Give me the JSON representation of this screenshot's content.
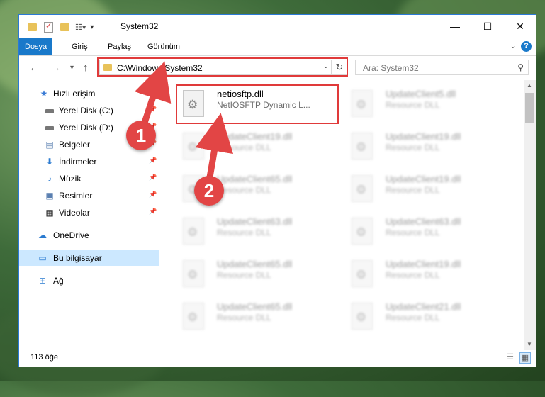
{
  "window": {
    "title": "System32",
    "controls": {
      "minimize": "—",
      "maximize": "☐",
      "close": "✕"
    }
  },
  "ribbon": {
    "tabs": [
      "Dosya",
      "Giriş",
      "Paylaş",
      "Görünüm"
    ],
    "help": "?"
  },
  "address": {
    "path": "C:\\Windows\\System32",
    "search_placeholder": "Ara: System32"
  },
  "navpane": {
    "items": [
      {
        "label": "Hızlı erişim",
        "icon": "star-icon",
        "pinned": false
      },
      {
        "label": "Yerel Disk (C:)",
        "icon": "drive-icon",
        "pinned": true
      },
      {
        "label": "Yerel Disk (D:)",
        "icon": "drive-icon",
        "pinned": true
      },
      {
        "label": "Belgeler",
        "icon": "document-icon",
        "pinned": true
      },
      {
        "label": "İndirmeler",
        "icon": "download-icon",
        "pinned": true
      },
      {
        "label": "Müzik",
        "icon": "music-icon",
        "pinned": true
      },
      {
        "label": "Resimler",
        "icon": "picture-icon",
        "pinned": true
      },
      {
        "label": "Videolar",
        "icon": "video-icon",
        "pinned": true
      },
      {
        "label": "OneDrive",
        "icon": "cloud-icon",
        "pinned": false
      },
      {
        "label": "Bu bilgisayar",
        "icon": "computer-icon",
        "pinned": false,
        "selected": true
      },
      {
        "label": "Ağ",
        "icon": "network-icon",
        "pinned": false
      }
    ]
  },
  "files": [
    {
      "name": "netiosftp.dll",
      "desc": "NetIOSFTP Dynamic L...",
      "highlighted": true
    },
    {
      "name": "UpdateClient5.dll",
      "desc": "Resource DLL"
    },
    {
      "name": "UpdateClient19.dll",
      "desc": "Resource DLL"
    },
    {
      "name": "UpdateClient19.dll",
      "desc": "Resource DLL"
    },
    {
      "name": "UpdateClient65.dll",
      "desc": "Resource DLL"
    },
    {
      "name": "UpdateClient19.dll",
      "desc": "Resource DLL"
    },
    {
      "name": "UpdateClient63.dll",
      "desc": "Resource DLL"
    },
    {
      "name": "UpdateClient63.dll",
      "desc": "Resource DLL"
    },
    {
      "name": "UpdateClient65.dll",
      "desc": "Resource DLL"
    },
    {
      "name": "UpdateClient19.dll",
      "desc": "Resource DLL"
    },
    {
      "name": "UpdateClient65.dll",
      "desc": "Resource DLL"
    },
    {
      "name": "UpdateClient21.dll",
      "desc": "Resource DLL"
    }
  ],
  "status": {
    "count": "113 öğe"
  },
  "annotations": {
    "step1": "1",
    "step2": "2"
  },
  "colors": {
    "accent": "#1979ca",
    "annotation": "#e24545",
    "selected": "#cce8ff"
  }
}
